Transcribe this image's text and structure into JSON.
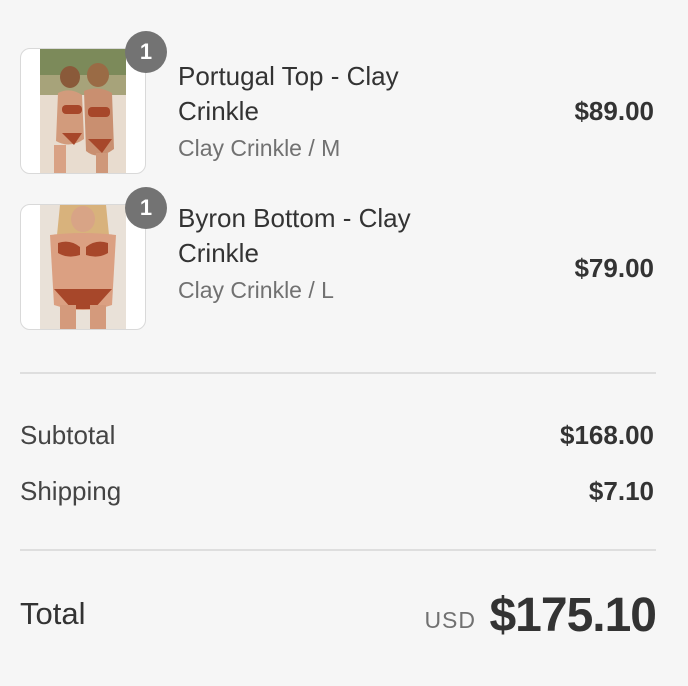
{
  "items": [
    {
      "quantity": "1",
      "name": "Portugal Top - Clay Crinkle",
      "variant": "Clay Crinkle / M",
      "price": "$89.00",
      "image": "product-photo-portugal-top"
    },
    {
      "quantity": "1",
      "name": "Byron Bottom - Clay Crinkle",
      "variant": "Clay Crinkle / L",
      "price": "$79.00",
      "image": "product-photo-byron-bottom"
    }
  ],
  "summary": {
    "subtotal_label": "Subtotal",
    "subtotal_value": "$168.00",
    "shipping_label": "Shipping",
    "shipping_value": "$7.10"
  },
  "total": {
    "label": "Total",
    "currency": "USD",
    "value": "$175.10"
  },
  "colors": {
    "badge": "#737373",
    "text": "#333333",
    "muted": "#717171",
    "background": "#f6f6f6"
  }
}
